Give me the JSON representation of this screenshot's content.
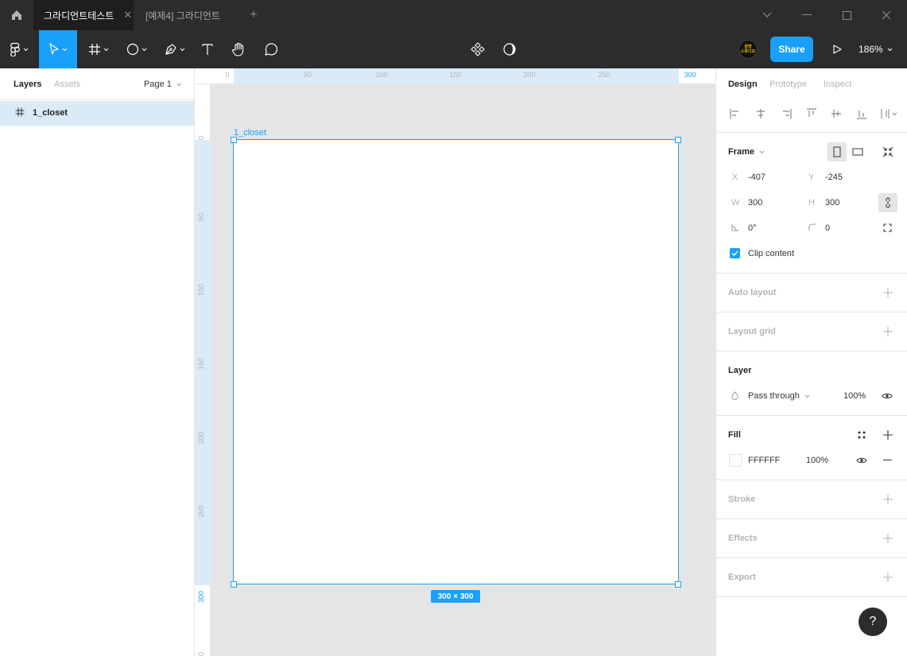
{
  "titlebar": {
    "tabs": [
      {
        "label": "그라디언트테스트",
        "close": "✕"
      },
      {
        "label": "[예제4] 그라디언트"
      }
    ],
    "add_tab": "+"
  },
  "toolbar": {
    "avatar_text": "광명\n스튜디오",
    "share_label": "Share",
    "zoom": "186%"
  },
  "left_panel": {
    "tabs": [
      "Layers",
      "Assets"
    ],
    "page": "Page 1",
    "layers": [
      {
        "name": "1_closet",
        "type": "frame"
      }
    ]
  },
  "rulers": {
    "top": [
      "0",
      "50",
      "100",
      "150",
      "200",
      "250",
      "300"
    ],
    "left": [
      "0",
      "50",
      "100",
      "150",
      "200",
      "250",
      "300",
      "0"
    ]
  },
  "canvas": {
    "frame_name": "1_closet",
    "size_badge": "300 × 300"
  },
  "right_panel": {
    "tabs": [
      "Design",
      "Prototype",
      "Inspect"
    ],
    "frame": {
      "title": "Frame",
      "x_label": "X",
      "x": "-407",
      "y_label": "Y",
      "y": "-245",
      "w_label": "W",
      "w": "300",
      "h_label": "H",
      "h": "300",
      "rotation": "0°",
      "radius": "0",
      "clip_content": "Clip content"
    },
    "auto_layout": "Auto layout",
    "layout_grid": "Layout grid",
    "layer": {
      "title": "Layer",
      "blend": "Pass through",
      "opacity": "100%"
    },
    "fill": {
      "title": "Fill",
      "hex": "FFFFFF",
      "opacity": "100%"
    },
    "stroke": "Stroke",
    "effects": "Effects",
    "export": "Export",
    "help": "?"
  },
  "colors": {
    "accent": "#18a0fb",
    "toolbar_bg": "#2c2c2c",
    "selection_bg": "#daebf7"
  }
}
